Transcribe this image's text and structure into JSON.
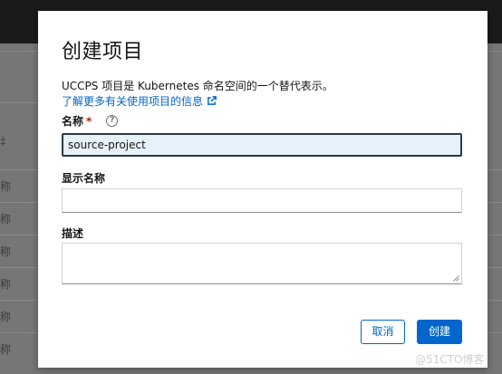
{
  "dialog": {
    "title": "创建项目",
    "description": "UCCPS 项目是 Kubernetes 命名空间的一个替代表示。",
    "learn_more_link": "了解更多有关使用项目的信息",
    "name_field": {
      "label": "名称",
      "required_mark": "*",
      "help_icon_glyph": "?",
      "value": "source-project"
    },
    "display_name_field": {
      "label": "显示名称",
      "value": ""
    },
    "description_field": {
      "label": "描述",
      "value": ""
    },
    "cancel_label": "取消",
    "create_label": "创建"
  },
  "background": {
    "row_glyphs": [
      "‡",
      "称",
      "称",
      "称",
      "称",
      "称",
      "称"
    ]
  },
  "watermark": "@51CTO博客",
  "colors": {
    "primary": "#0066cc",
    "required": "#c9190b",
    "focused_input_bg": "#e7f1fa",
    "topbar": "#1b1b1b"
  }
}
